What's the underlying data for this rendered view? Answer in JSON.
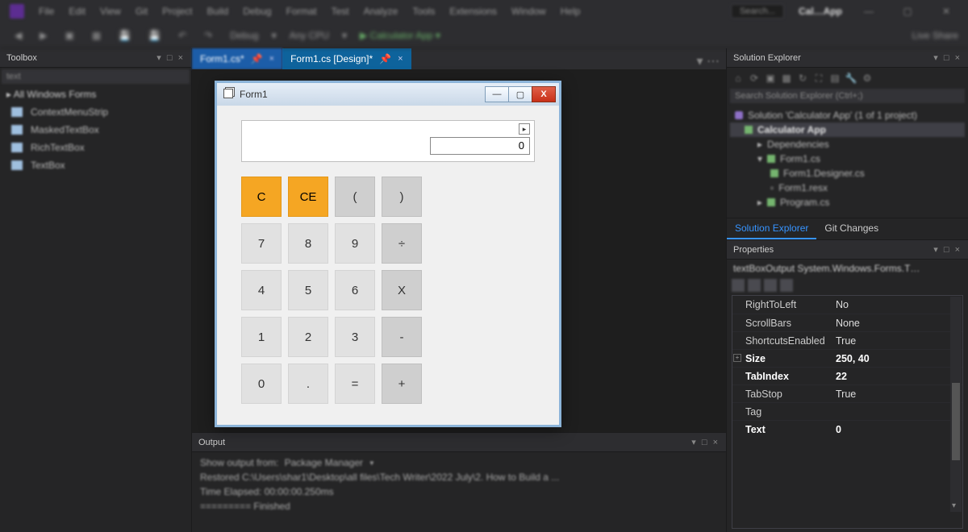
{
  "menubar": {
    "items": [
      "File",
      "Edit",
      "View",
      "Git",
      "Project",
      "Build",
      "Debug",
      "Format",
      "Test",
      "Analyze",
      "Tools",
      "Extensions",
      "Window",
      "Help"
    ],
    "search_placeholder": "Search...",
    "project_name": "Cal…App",
    "share": "Live Share"
  },
  "toolbar": {
    "config": "Debug",
    "platform": "Any CPU",
    "run_target": "Calculator App"
  },
  "toolbox": {
    "title": "Toolbox",
    "filter": "text",
    "category": "▸ All Windows Forms",
    "items": [
      "ContextMenuStrip",
      "MaskedTextBox",
      "RichTextBox",
      "TextBox"
    ]
  },
  "tabs": {
    "tab1": "Form1.cs*",
    "tab2": "Form1.cs [Design]*"
  },
  "form": {
    "title": "Form1",
    "display_value": "0",
    "buttons": {
      "row1": [
        "C",
        "CE",
        "(",
        ")"
      ],
      "row2": [
        "7",
        "8",
        "9",
        "÷"
      ],
      "row3": [
        "4",
        "5",
        "6",
        "X"
      ],
      "row4": [
        "1",
        "2",
        "3",
        "-"
      ],
      "row5": [
        "0",
        ".",
        "=",
        "+"
      ]
    }
  },
  "output": {
    "title": "Output",
    "from_label": "Show output from:",
    "from_value": "Package Manager",
    "line1": "Restored C:\\Users\\shar1\\Desktop\\all files\\Tech Writer\\2022 July\\2. How to Build a ...",
    "line2": "Time Elapsed: 00:00:00.250ms",
    "line3": "========= Finished"
  },
  "solution_explorer": {
    "title": "Solution Explorer",
    "search_placeholder": "Search Solution Explorer (Ctrl+;)",
    "nodes": {
      "solution": "Solution 'Calculator App' (1 of 1 project)",
      "project": "Calculator App",
      "deps": "Dependencies",
      "form": "Form1.cs",
      "designer": "Form1.Designer.cs",
      "resx": "Form1.resx",
      "program": "Program.cs"
    },
    "subtabs": {
      "a": "Solution Explorer",
      "b": "Git Changes"
    }
  },
  "properties": {
    "title": "Properties",
    "target": "textBoxOutput  System.Windows.Forms.T…",
    "rows": [
      {
        "k": "RightToLeft",
        "v": "No",
        "bold": false
      },
      {
        "k": "ScrollBars",
        "v": "None",
        "bold": false
      },
      {
        "k": "ShortcutsEnabled",
        "v": "True",
        "bold": false
      },
      {
        "k": "Size",
        "v": "250, 40",
        "bold": true
      },
      {
        "k": "TabIndex",
        "v": "22",
        "bold": true
      },
      {
        "k": "TabStop",
        "v": "True",
        "bold": false
      },
      {
        "k": "Tag",
        "v": "",
        "bold": false
      },
      {
        "k": "Text",
        "v": "0",
        "bold": true
      }
    ]
  }
}
